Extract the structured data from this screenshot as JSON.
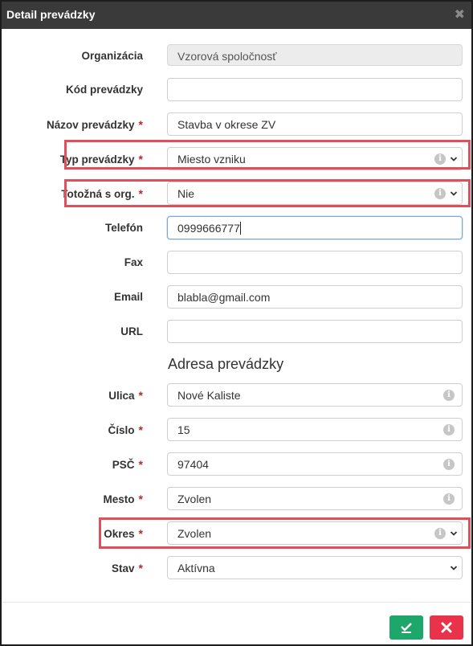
{
  "dialog": {
    "title": "Detail prevádzky"
  },
  "fields": {
    "organizacia": {
      "label": "Organizácia",
      "value": "Vzorová spoločnosť"
    },
    "kod": {
      "label": "Kód prevádzky",
      "value": ""
    },
    "nazov": {
      "label": "Názov prevádzky",
      "value": "Stavba v okrese ZV",
      "required": "*"
    },
    "typ": {
      "label": "Typ prevádzky",
      "value": "Miesto vzniku",
      "required": "*"
    },
    "totozna": {
      "label": "Totožná s org.",
      "value": "Nie",
      "required": "*"
    },
    "telefon": {
      "label": "Telefón",
      "value": "0999666777"
    },
    "fax": {
      "label": "Fax",
      "value": ""
    },
    "email": {
      "label": "Email",
      "value": "blabla@gmail.com"
    },
    "url": {
      "label": "URL",
      "value": ""
    }
  },
  "address": {
    "section_title": "Adresa prevádzky",
    "ulica": {
      "label": "Ulica",
      "value": "Nové Kaliste",
      "required": "*"
    },
    "cislo": {
      "label": "Číslo",
      "value": "15",
      "required": "*"
    },
    "psc": {
      "label": "PSČ",
      "value": "97404",
      "required": "*"
    },
    "mesto": {
      "label": "Mesto",
      "value": "Zvolen",
      "required": "*"
    },
    "okres": {
      "label": "Okres",
      "value": "Zvolen",
      "required": "*"
    },
    "stav": {
      "label": "Stav",
      "value": "Aktívna",
      "required": "*"
    }
  },
  "info_glyph": "i",
  "close_glyph": "✖",
  "colors": {
    "accent_save": "#1ea76a",
    "accent_cancel": "#e8334a",
    "highlight": "#e0505a",
    "required": "#b52a2a"
  },
  "icons": {
    "close": "close-icon",
    "save": "save-check-icon",
    "cancel": "cancel-x-icon",
    "info": "info-icon",
    "dropdown": "chevron-down-icon"
  }
}
